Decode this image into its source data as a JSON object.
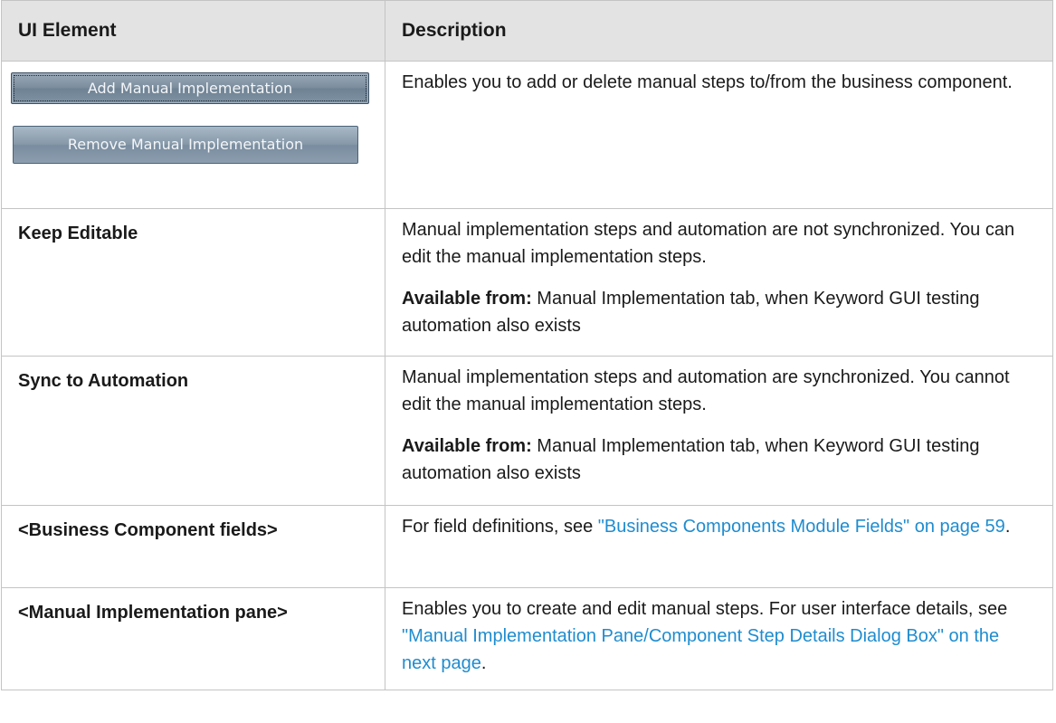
{
  "table": {
    "headers": {
      "element": "UI Element",
      "description": "Description"
    },
    "row1": {
      "add_button": "Add Manual Implementation",
      "remove_button": "Remove Manual Implementation",
      "description": "Enables you to add or delete manual steps to/from the business component."
    },
    "row2": {
      "element": "Keep Editable",
      "description": "Manual implementation steps and automation are not synchronized. You can edit the manual implementation steps.",
      "available_label": "Available from:",
      "available_text": " Manual Implementation tab, when Keyword GUI testing automation also exists"
    },
    "row3": {
      "element": "Sync to Automation",
      "description": "Manual implementation steps and automation are synchronized. You cannot edit the manual implementation steps.",
      "available_label": "Available from:",
      "available_text": " Manual Implementation tab, when Keyword GUI testing automation also exists"
    },
    "row4": {
      "element": "<Business Component fields>",
      "desc_prefix": "For field definitions, see ",
      "link": "\"Business Components Module Fields\" on page 59",
      "desc_suffix": "."
    },
    "row5": {
      "element": "<Manual Implementation pane>",
      "desc_prefix": "Enables you to create and edit manual steps. For user interface details, see ",
      "link": "\"Manual Implementation Pane/Component Step Details Dialog Box\" on the next page",
      "desc_suffix": "."
    }
  },
  "colors": {
    "header_bg": "#e3e3e3",
    "border": "#c4c4c4",
    "link": "#1f8ccf",
    "button_bg": "#7b8d9e"
  }
}
